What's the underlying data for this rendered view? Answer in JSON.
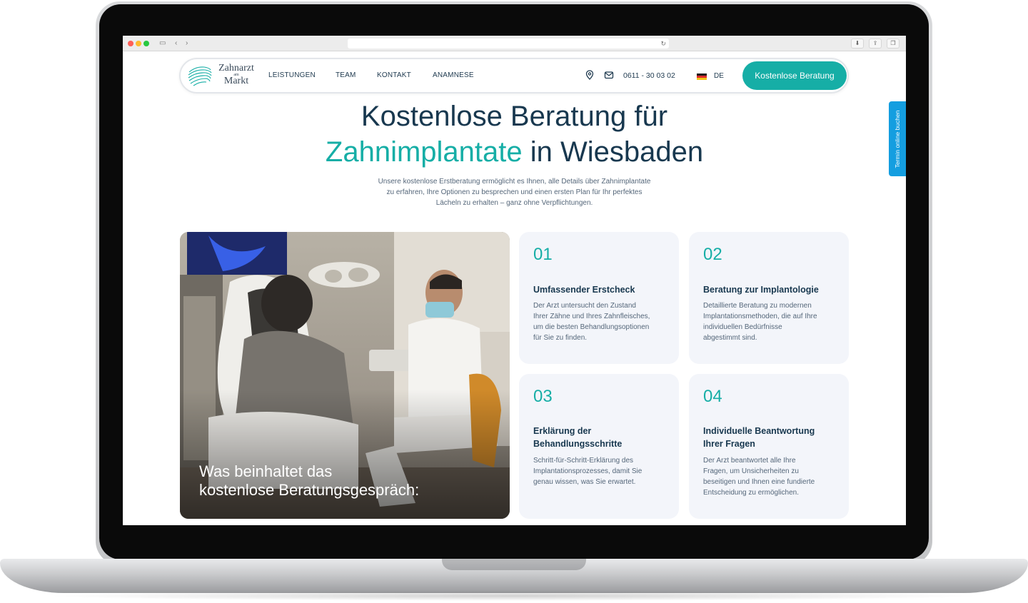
{
  "browser": {
    "url": "",
    "nav_back": "‹",
    "nav_forward": "›",
    "reload": "↻"
  },
  "header": {
    "logo": {
      "line1": "Zahnarzt",
      "line2": "am",
      "line3": "Markt"
    },
    "nav": [
      "LEISTUNGEN",
      "TEAM",
      "KONTAKT",
      "ANAMNESE"
    ],
    "phone": "0611 - 30 03 02",
    "language": "DE",
    "cta_label": "Kostenlose Beratung"
  },
  "side_tab": {
    "label": "Termin online buchen"
  },
  "hero": {
    "title_line1": "Kostenlose Beratung für",
    "title_accent": "Zahnimplantate",
    "title_rest": " in Wiesbaden",
    "subtitle_line1": "Unsere kostenlose Erstberatung ermöglicht es Ihnen, alle Details über Zahnimplantate",
    "subtitle_line2": "zu erfahren, Ihre Optionen zu besprechen und einen ersten Plan für Ihr perfektes",
    "subtitle_line3": "Lächeln zu erhalten – ganz ohne Verpflichtungen."
  },
  "photo": {
    "caption_line1": "Was beinhaltet das",
    "caption_line2": "kostenlose Beratungsgespräch:"
  },
  "steps": [
    {
      "number": "01",
      "title_lines": [
        "Umfassender Erstcheck"
      ],
      "text_lines": [
        "Der Arzt untersucht den Zustand",
        "Ihrer Zähne und Ihres Zahnfleisches,",
        "um die besten Behandlungsoptionen",
        "für Sie zu finden."
      ]
    },
    {
      "number": "02",
      "title_lines": [
        "Beratung zur Implantologie"
      ],
      "text_lines": [
        "Detaillierte Beratung zu modernen",
        "Implantationsmethoden, die auf Ihre",
        "individuellen Bedürfnisse",
        "abgestimmt sind."
      ]
    },
    {
      "number": "03",
      "title_lines": [
        "Erklärung der",
        "Behandlungsschritte"
      ],
      "text_lines": [
        "Schritt-für-Schritt-Erklärung des",
        "Implantationsprozesses, damit Sie",
        "genau wissen, was Sie erwartet."
      ]
    },
    {
      "number": "04",
      "title_lines": [
        "Individuelle Beantwortung",
        "Ihrer Fragen"
      ],
      "text_lines": [
        "Der Arzt beantwortet alle Ihre",
        "Fragen, um Unsicherheiten zu",
        "beseitigen und Ihnen eine fundierte",
        "Entscheidung zu ermöglichen."
      ]
    }
  ],
  "colors": {
    "accent": "#16aea6",
    "heading": "#18384f",
    "side_tab": "#149ee0",
    "card_bg": "#f3f5fa"
  }
}
